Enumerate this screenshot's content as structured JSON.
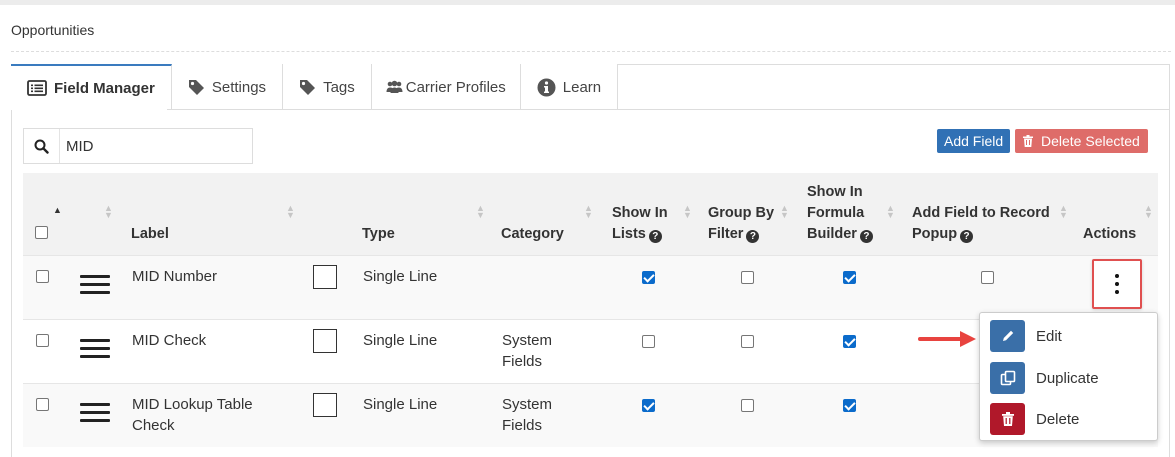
{
  "page": {
    "title": "Opportunities"
  },
  "tabs": [
    {
      "label": "Field Manager",
      "icon": "list-icon",
      "active": true
    },
    {
      "label": "Settings",
      "icon": "tag-icon",
      "active": false
    },
    {
      "label": "Tags",
      "icon": "tag-icon",
      "active": false
    },
    {
      "label": "Carrier Profiles",
      "icon": "users-icon",
      "active": false
    },
    {
      "label": "Learn",
      "icon": "info-icon",
      "active": false
    }
  ],
  "search": {
    "value": "MID",
    "icon": "search-icon"
  },
  "toolbar": {
    "add_label": "Add Field",
    "delete_label": "Delete Selected"
  },
  "table": {
    "headers": {
      "label": "Label",
      "type": "Type",
      "category": "Category",
      "show_in_lists_1": "Show In",
      "show_in_lists_2": "Lists",
      "group_by_filter_1": "Group By",
      "group_by_filter_2": "Filter",
      "formula_1": "Show In",
      "formula_2": "Formula",
      "formula_3": "Builder",
      "popup_1": "Add Field to Record",
      "popup_2": "Popup",
      "actions": "Actions",
      "help_glyph": "?"
    },
    "rows": [
      {
        "label_1": "MID Number",
        "label_2": "",
        "type": "Single Line",
        "category_1": "",
        "category_2": "",
        "show_in_lists": true,
        "group_by_filter": false,
        "formula_builder": true,
        "record_popup": false
      },
      {
        "label_1": "MID Check",
        "label_2": "",
        "type": "Single Line",
        "category_1": "System",
        "category_2": "Fields",
        "show_in_lists": false,
        "group_by_filter": false,
        "formula_builder": true,
        "record_popup": null
      },
      {
        "label_1": "MID Lookup Table",
        "label_2": "Check",
        "type": "Single Line",
        "category_1": "System",
        "category_2": "Fields",
        "show_in_lists": true,
        "group_by_filter": false,
        "formula_builder": true,
        "record_popup": null
      }
    ]
  },
  "actions_menu": {
    "items": [
      {
        "label": "Edit",
        "icon": "pencil-icon",
        "color": "#3a6fa8"
      },
      {
        "label": "Duplicate",
        "icon": "copy-icon",
        "color": "#3a6fa8"
      },
      {
        "label": "Delete",
        "icon": "trash-icon",
        "color": "#b0182a"
      }
    ]
  },
  "colors": {
    "primary": "#3171b5",
    "danger": "#d9534f",
    "highlight": "#e05050"
  }
}
